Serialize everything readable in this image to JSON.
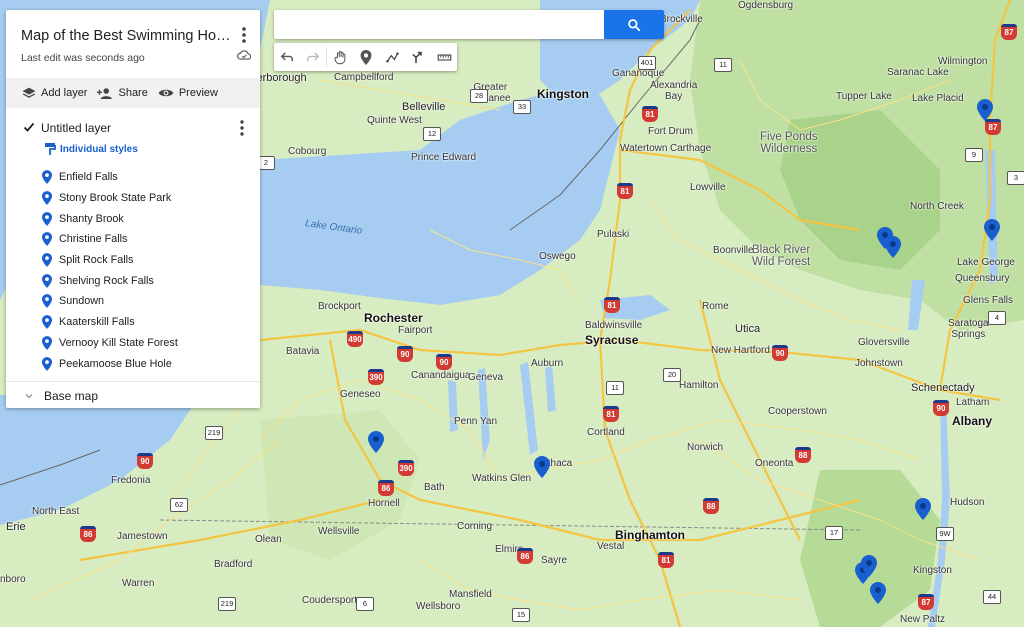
{
  "search": {
    "value": "",
    "placeholder": ""
  },
  "panel": {
    "title": "Map of the Best Swimming Holes...",
    "subtitle": "Last edit was seconds ago",
    "actions": {
      "add_layer": "Add layer",
      "share": "Share",
      "preview": "Preview"
    },
    "layer": {
      "name": "Untitled layer",
      "checked": true,
      "style_label": "Individual styles",
      "places": [
        "Enfield Falls",
        "Stony Brook State Park",
        "Shanty Brook",
        "Christine Falls",
        "Split Rock Falls",
        "Shelving Rock Falls",
        "Sundown",
        "Kaaterskill Falls",
        "Vernooy Kill State Forest",
        "Peekamoose Blue Hole"
      ]
    },
    "base_map_label": "Base map"
  },
  "toolbar": {
    "tools": [
      "undo-icon",
      "redo-icon",
      "hand-icon",
      "marker-icon",
      "line-icon",
      "directions-icon",
      "ruler-icon"
    ]
  },
  "map": {
    "water_labels": {
      "lake_ontario": "Lake Ontario"
    },
    "regions": {
      "five_ponds": "Five Ponds\nWilderness",
      "black_river": "Black River\nWild Forest"
    },
    "places": {
      "peterborough": "Peterborough",
      "campbellford": "Campbellford",
      "belleville": "Belleville",
      "quinte_west": "Quinte West",
      "cobourg": "Cobourg",
      "greater_napanee": "Greater\nNapanee",
      "kingston": "Kingston",
      "prince_edward": "Prince Edward",
      "gananoque": "Gananoque",
      "alexandria_bay": "Alexandria\nBay",
      "brockville": "Brockville",
      "ogdensburg": "Ogdensburg",
      "fort_drum": "Fort Drum",
      "watertown": "Watertown",
      "carthage": "Carthage",
      "lowville": "Lowville",
      "saranac_lake": "Saranac Lake",
      "tupper_lake": "Tupper Lake",
      "lake_placid": "Lake Placid",
      "wilmington": "Wilmington",
      "north_creek": "North Creek",
      "lake_george": "Lake George",
      "queensbury": "Queensbury",
      "glens_falls": "Glens Falls",
      "saratoga_springs": "Saratoga\nSprings",
      "pulaski": "Pulaski",
      "boonville": "Boonville",
      "oswego": "Oswego",
      "rome": "Rome",
      "utica": "Utica",
      "new_hartford": "New Hartford",
      "gloversville": "Gloversville",
      "johnstown": "Johnstown",
      "schenectady": "Schenectady",
      "latham": "Latham",
      "albany": "Albany",
      "brockport": "Brockport",
      "rochester": "Rochester",
      "fairport": "Fairport",
      "baldwinsville": "Baldwinsville",
      "syracuse": "Syracuse",
      "batavia": "Batavia",
      "canandaigua": "Canandaigua",
      "geneva": "Geneva",
      "auburn": "Auburn",
      "hamilton": "Hamilton",
      "cooperstown": "Cooperstown",
      "geneseo": "Geneseo",
      "penn_yan": "Penn Yan",
      "cortland": "Cortland",
      "norwich": "Norwich",
      "oneonta": "Oneonta",
      "ithaca": "Ithaca",
      "watkins_glen": "Watkins Glen",
      "bath": "Bath",
      "hornell": "Hornell",
      "fredonia": "Fredonia",
      "north_east": "North East",
      "erie": "Erie",
      "jamestown": "Jamestown",
      "wellsville": "Wellsville",
      "olean": "Olean",
      "corning": "Corning",
      "elmira": "Elmira",
      "binghamton": "Binghamton",
      "vestal": "Vestal",
      "sayre": "Sayre",
      "bradford": "Bradford",
      "warren": "Warren",
      "coudersport": "Coudersport",
      "mansfield": "Mansfield",
      "wellsboro": "Wellsboro",
      "kingston_ny": "Kingston",
      "hudson": "Hudson",
      "new_paltz": "New Paltz",
      "bradford_pa": "nboro"
    },
    "shields": [
      "401",
      "81",
      "87",
      "11",
      "9",
      "3",
      "12",
      "90",
      "490",
      "390",
      "20",
      "88",
      "86",
      "219",
      "62",
      "6",
      "17",
      "9W",
      "44",
      "15",
      "33",
      "28",
      "2",
      "4"
    ]
  }
}
